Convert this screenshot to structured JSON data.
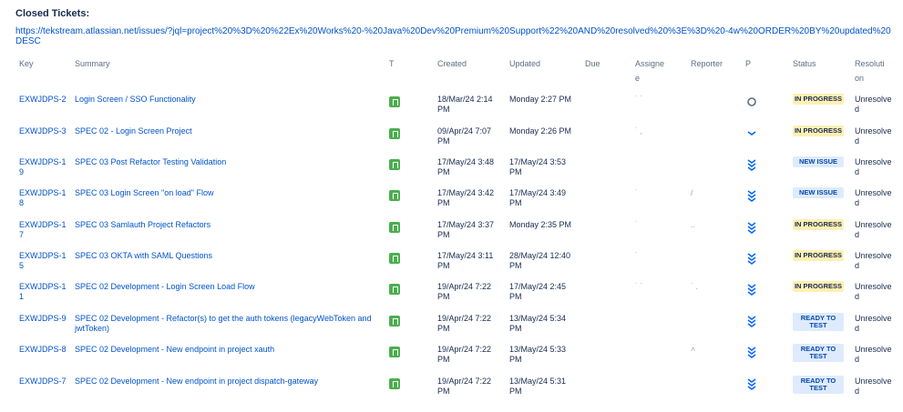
{
  "heading": "Closed Tickets:",
  "url": "https://tekstream.atlassian.net/issues/?jql=project%20%3D%20%22Ex%20Works%20-%20Java%20Dev%20Premium%20Support%22%20AND%20resolved%20%3E%3D%20-4w%20ORDER%20BY%20updated%20DESC",
  "columns": {
    "key": "Key",
    "summary": "Summary",
    "type": "T",
    "created": "Created",
    "updated": "Updated",
    "due": "Due",
    "assignee": "Assignee",
    "reporter": "Reporter",
    "priority": "P",
    "status": "Status",
    "resolution": "Resolution"
  },
  "rows": [
    {
      "key": "EXWJDPS-2",
      "summary": "Login Screen / SSO Functionality",
      "created": "18/Mar/24 2:14 PM",
      "updated": "Monday 2:27 PM",
      "assignee": "˙ ˙",
      "reporter": "",
      "priority": "medium",
      "status": "IN PROGRESS",
      "status_kind": "prog",
      "resolution": "Unresolved"
    },
    {
      "key": "EXWJDPS-3",
      "summary": "SPEC 02 - Login Screen Project",
      "created": "09/Apr/24 7:07 PM",
      "updated": "Monday 2:26 PM",
      "assignee": "˙ ,",
      "reporter": "",
      "priority": "low",
      "status": "IN PROGRESS",
      "status_kind": "prog",
      "resolution": "Unresolved"
    },
    {
      "key": "EXWJDPS-19",
      "summary": "SPEC 03 Post Refactor Testing Validation",
      "created": "17/May/24 3:48 PM",
      "updated": "17/May/24 3:53 PM",
      "assignee": "",
      "reporter": "",
      "priority": "lowest",
      "status": "NEW ISSUE",
      "status_kind": "new",
      "resolution": "Unresolved"
    },
    {
      "key": "EXWJDPS-18",
      "summary": "SPEC 03 Login Screen \"on load\" Flow",
      "created": "17/May/24 3:42 PM",
      "updated": "17/May/24 3:49 PM",
      "assignee": "˙",
      "reporter": "/",
      "priority": "lowest",
      "status": "NEW ISSUE",
      "status_kind": "new",
      "resolution": "Unresolved"
    },
    {
      "key": "EXWJDPS-17",
      "summary": "SPEC 03 Samlauth Project Refactors",
      "created": "17/May/24 3:37 PM",
      "updated": "Monday 2:35 PM",
      "assignee": "˙",
      "reporter": "..",
      "priority": "lowest",
      "status": "IN PROGRESS",
      "status_kind": "prog",
      "resolution": "Unresolved"
    },
    {
      "key": "EXWJDPS-15",
      "summary": "SPEC 03 OKTA with SAML Questions",
      "created": "17/May/24 3:11 PM",
      "updated": "28/May/24 12:40 PM",
      "assignee": "˙",
      "reporter": "",
      "priority": "lowest",
      "status": "IN PROGRESS",
      "status_kind": "prog",
      "resolution": "Unresolved"
    },
    {
      "key": "EXWJDPS-11",
      "summary": "SPEC 02 Development - Login Screen Load Flow",
      "created": "19/Apr/24 7:22 PM",
      "updated": "17/May/24 2:45 PM",
      "assignee": "˙ ˙",
      "reporter": "˙ .",
      "priority": "lowest",
      "status": "IN PROGRESS",
      "status_kind": "prog",
      "resolution": "Unresolved"
    },
    {
      "key": "EXWJDPS-9",
      "summary": "SPEC 02 Development - Refactor(s) to get the auth tokens (legacyWebToken and jwtToken)",
      "created": "19/Apr/24 7:22 PM",
      "updated": "13/May/24 5:34 PM",
      "assignee": "",
      "reporter": "",
      "priority": "lowest",
      "status": "READY TO TEST",
      "status_kind": "ready",
      "resolution": "Unresolved"
    },
    {
      "key": "EXWJDPS-8",
      "summary": "SPEC 02 Development - New endpoint in project xauth",
      "created": "19/Apr/24 7:22 PM",
      "updated": "13/May/24 5:33 PM",
      "assignee": "",
      "reporter": "˄",
      "priority": "lowest",
      "status": "READY TO TEST",
      "status_kind": "ready",
      "resolution": "Unresolved"
    },
    {
      "key": "EXWJDPS-7",
      "summary": "SPEC 02 Development - New endpoint in project dispatch-gateway",
      "created": "19/Apr/24 7:22 PM",
      "updated": "13/May/24 5:31 PM",
      "assignee": "",
      "reporter": "",
      "priority": "lowest",
      "status": "READY TO TEST",
      "status_kind": "ready",
      "resolution": "Unresolved"
    }
  ],
  "colors": {
    "link": "#0052cc",
    "in_progress_bg": "#fff0b3",
    "new_bg": "#deebff",
    "story_icon": "#4bae4f",
    "priority": "#0065ff"
  }
}
